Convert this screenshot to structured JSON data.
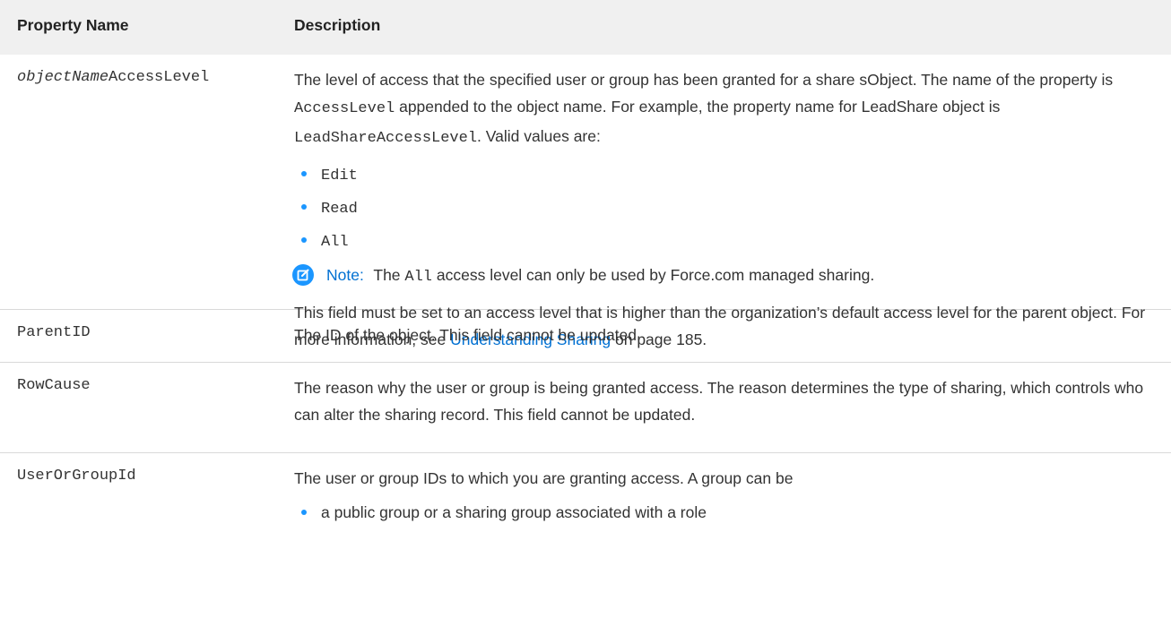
{
  "table": {
    "headers": {
      "name": "Property Name",
      "description": "Description"
    },
    "rows": [
      {
        "name_italic": "objectName",
        "name_rest": "AccessLevel",
        "desc": {
          "p1_a": "The level of access that the specified user or group has been granted for a share sObject. The name of the property is ",
          "p1_code1": "AccessLevel",
          "p1_b": " appended to the object name. For example, the property name for LeadShare object is ",
          "p1_code2": "LeadShareAccessLevel",
          "p1_c": ". Valid values are:",
          "values": [
            "Edit",
            "Read",
            "All"
          ],
          "note_label": "Note:",
          "note_a": " The ",
          "note_code": "All",
          "note_b": " access level can only be used by Force.com managed sharing.",
          "p2_a": "This field must be set to an access level that is higher than the organization’s default access level for the parent object. For more information, see ",
          "p2_link": "Understanding Sharing",
          "p2_b": " on page 185."
        }
      },
      {
        "name": "ParentID",
        "desc": "The ID of the object. This field cannot be updated."
      },
      {
        "name": "RowCause",
        "desc": "The reason why the user or group is being granted access. The reason determines the type of sharing, which controls who can alter the sharing record. This field cannot be updated."
      },
      {
        "name": "UserOrGroupId",
        "desc": "The user or group IDs to which you are granting access. A group can be",
        "bullet": "a public group or a sharing group associated with a role"
      }
    ]
  },
  "colors": {
    "header_bg": "#f0f0f0",
    "accent": "#1b96ff",
    "link": "#0070d2"
  },
  "icons": {
    "note": "edit-note-icon"
  }
}
